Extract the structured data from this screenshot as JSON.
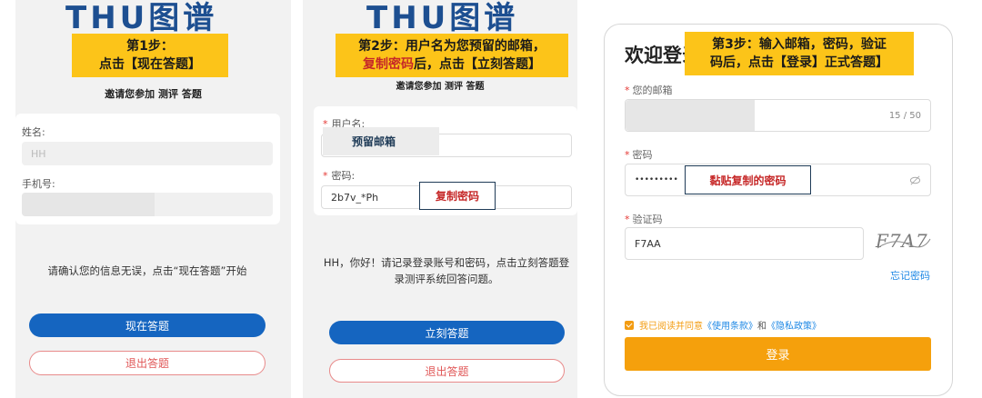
{
  "panel1": {
    "logo": "THU图谱",
    "step_badge_line1": "第1步：",
    "step_badge_line2": "点击【现在答题】",
    "subtitle": "邀请您参加 测评 答题",
    "name_label": "姓名:",
    "name_value": "HH",
    "phone_label": "手机号:",
    "confirm_msg": "请确认您的信息无误，点击“现在答题”开始",
    "primary_button": "现在答题",
    "exit_button": "退出答题"
  },
  "panel2": {
    "logo": "THU图谱",
    "step_badge_line1": "第2步：用户名为您预留的邮箱，",
    "step_badge_line2_red": "复制密码",
    "step_badge_line2_rest": "后，点击【立刻答题】",
    "subtitle": "邀请您参加 测评 答题",
    "username_label": "用户名:",
    "username_callout": "预留邮箱",
    "password_label": "密码:",
    "password_value": "2b7v_*Ph",
    "password_callout": "复制密码",
    "message": "HH，你好！请记录登录账号和密码，点击立刻答题登录测评系统回答问题。",
    "primary_button": "立刻答题",
    "exit_button": "退出答题"
  },
  "panel3": {
    "title": "欢迎登录",
    "step_badge_line1": "第3步：输入邮箱，密码，验证",
    "step_badge_line2": "码后，点击【登录】正式答题】",
    "email_label": "您的邮箱",
    "email_counter": "15 / 50",
    "password_label": "密码",
    "password_value": "•••••••••",
    "password_callout": "黏贴复制的密码",
    "captcha_label": "验证码",
    "captcha_value": "F7AA",
    "captcha_image_text": "F7A7",
    "forgot_link": "忘记密码",
    "agree_prefix": "我已阅读并同意",
    "terms_link": "《使用条款》",
    "agree_and": "和",
    "privacy_link": "《隐私政策》",
    "login_button": "登录"
  },
  "colors": {
    "badge": "#fcc419",
    "primary_blue": "#1565c0",
    "login_orange": "#f5a00c",
    "highlight_red": "#c62828"
  }
}
